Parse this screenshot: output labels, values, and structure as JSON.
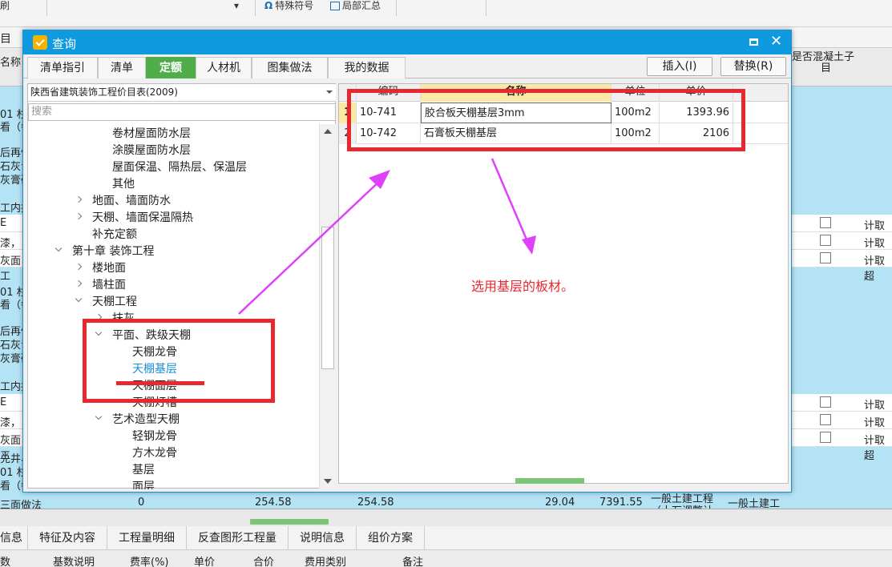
{
  "background": {
    "toolbar": {
      "btn1": "局部汇总",
      "btn2": "特殊符号",
      "frag_left": "刷",
      "omega": "Ω"
    },
    "row2_frag": "目",
    "header": {
      "name_col": "名称",
      "concrete_col_line1": "是否混凝土子",
      "concrete_col_line2": "目"
    },
    "left_frags": [
      "01 杉",
      "看（每",
      "后再做",
      "石灰青",
      "灰膏砂",
      "工内挡",
      "E",
      "漆，抹",
      "灰面工",
      "01 杉",
      "看（每",
      "后再做",
      "石灰青",
      "灰膏砂",
      "工内挡",
      "E",
      "漆，抹",
      "灰面工",
      "兑井、",
      "01 杉",
      "看（每"
    ],
    "right_rows": [
      "计取超",
      "计取超",
      "计取超",
      "计取超",
      "计取超",
      "计取超"
    ],
    "bottom_row": {
      "c1": "三面做法",
      "c2": "0",
      "c3": "254.58",
      "c4": "254.58",
      "c5": "29.04",
      "c6": "7391.55",
      "c7_line1": "一般土建工程",
      "c7_line2": "（土石调整计",
      "c8": "一般土建工"
    },
    "bottom_tabs": [
      "信息",
      "特征及内容",
      "工程量明细",
      "反查图形工程量",
      "说明信息",
      "组价方案"
    ],
    "footer_cols": [
      "数",
      "基数说明",
      "费率(%)",
      "单价",
      "合价",
      "费用类别",
      "备注"
    ]
  },
  "dialog": {
    "title": "查询",
    "tabs": [
      "清单指引",
      "清单",
      "定额",
      "人材机",
      "图集做法",
      "我的数据"
    ],
    "active_tab_index": 2,
    "insert_button": "插入(I)",
    "replace_button": "替换(R)",
    "library": "陕西省建筑装饰工程价目表(2009)",
    "search_placeholder": "搜索",
    "tree": [
      {
        "label": "卷材屋面防水层",
        "expander": "none"
      },
      {
        "label": "涂膜屋面防水层",
        "expander": "none"
      },
      {
        "label": "屋面保温、隔热层、保温层",
        "expander": "none"
      },
      {
        "label": "其他",
        "expander": "none"
      },
      {
        "label": "地面、墙面防水",
        "expander": "collapsed"
      },
      {
        "label": "天棚、墙面保温隔热",
        "expander": "collapsed"
      },
      {
        "label": "补充定额",
        "expander": "none"
      },
      {
        "label": "第十章 装饰工程",
        "expander": "expanded"
      },
      {
        "label": "楼地面",
        "expander": "collapsed"
      },
      {
        "label": "墙柱面",
        "expander": "collapsed"
      },
      {
        "label": "天棚工程",
        "expander": "expanded"
      },
      {
        "label": "抹灰",
        "expander": "collapsed"
      },
      {
        "label": "平面、跌级天棚",
        "expander": "expanded"
      },
      {
        "label": "天棚龙骨",
        "expander": "none"
      },
      {
        "label": "天棚基层",
        "expander": "none",
        "selected": true
      },
      {
        "label": "天棚面层",
        "expander": "none"
      },
      {
        "label": "天棚灯槽",
        "expander": "none"
      },
      {
        "label": "艺术造型天棚",
        "expander": "expanded"
      },
      {
        "label": "轻钢龙骨",
        "expander": "none"
      },
      {
        "label": "方木龙骨",
        "expander": "none"
      },
      {
        "label": "基层",
        "expander": "none"
      },
      {
        "label": "面层",
        "expander": "none"
      }
    ],
    "table": {
      "headers": [
        "编码",
        "名称",
        "单位",
        "单价"
      ],
      "rows": [
        {
          "no": "1",
          "code": "10-741",
          "name": "胶合板天棚基层3mm",
          "unit": "100m2",
          "price": "1393.96"
        },
        {
          "no": "2",
          "code": "10-742",
          "name": "石膏板天棚基层",
          "unit": "100m2",
          "price": "2106"
        }
      ]
    }
  },
  "annotation": {
    "note": "选用基层的板材。",
    "color": "#e8282f",
    "arrow_color": "#e040fb"
  }
}
